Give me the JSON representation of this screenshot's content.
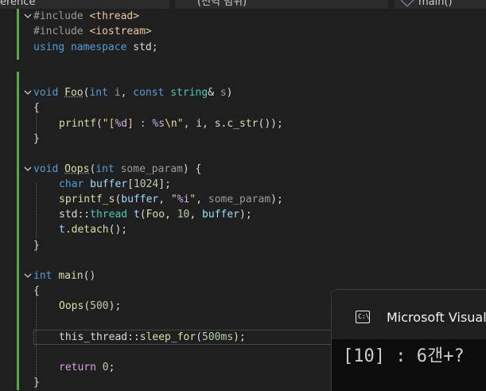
{
  "tabs": [
    {
      "label": "erence"
    },
    {
      "label": "(전역 범위)"
    },
    {
      "label": "main()"
    }
  ],
  "code": {
    "l1": {
      "a": "#include ",
      "b": "<thread>"
    },
    "l2": {
      "a": "#include ",
      "b": "<iostream>"
    },
    "l3": {
      "a": "using",
      "b": " ",
      "c": "namespace",
      "d": " std;"
    },
    "foo_sig": {
      "a": "void",
      "b": " ",
      "c": "Foo",
      "d": "(",
      "e": "int",
      "f": " ",
      "g": "i",
      "h": ", ",
      "i": "const",
      "j": " ",
      "k": "string",
      "l": "& ",
      "m": "s",
      "n": ")"
    },
    "brace_open": "{",
    "brace_close": "}",
    "printf": {
      "a": "printf",
      "b": "(",
      "c": "\"[",
      "d": "%d",
      "e": "] : ",
      "f": "%s",
      "g": "\\n",
      "h": "\"",
      "i": ", i, s.",
      "j": "c_str",
      "k": "());"
    },
    "oops_sig": {
      "a": "void",
      "b": " ",
      "c": "Oops",
      "d": "(",
      "e": "int",
      "f": " ",
      "g": "some_param",
      "h": ") {"
    },
    "char_line": {
      "a": "char",
      "b": " ",
      "c": "buffer",
      "d": "[",
      "e": "1024",
      "f": "];"
    },
    "sprintf": {
      "a": "sprintf_s",
      "b": "(",
      "c": "buffer",
      "d": ", ",
      "e": "\"",
      "f": "%i",
      "g": "\"",
      "h": ", ",
      "i": "some_param",
      "j": ");"
    },
    "thread_line": {
      "a": "std",
      "b": "::",
      "c": "thread",
      "d": " ",
      "e": "t",
      "f": "(",
      "g": "Foo",
      "h": ", ",
      "i": "10",
      "j": ", ",
      "k": "buffer",
      "l": ");"
    },
    "detach": {
      "a": "t",
      "b": ".",
      "c": "detach",
      "d": "();"
    },
    "main_sig": {
      "a": "int",
      "b": " ",
      "c": "main",
      "d": "()"
    },
    "oops_call": {
      "a": "Oops",
      "b": "(",
      "c": "500",
      "d": ");"
    },
    "sleep": {
      "a": "this_thread",
      "b": "::",
      "c": "sleep_for",
      "d": "(",
      "e": "500ms",
      "f": ");"
    },
    "ret": {
      "a": "return",
      "b": " ",
      "c": "0",
      "d": ";"
    }
  },
  "console": {
    "icon_text": "C:\\",
    "title": "Microsoft Visual Studio Debug Console",
    "output": "[10] : 6갠+?"
  }
}
